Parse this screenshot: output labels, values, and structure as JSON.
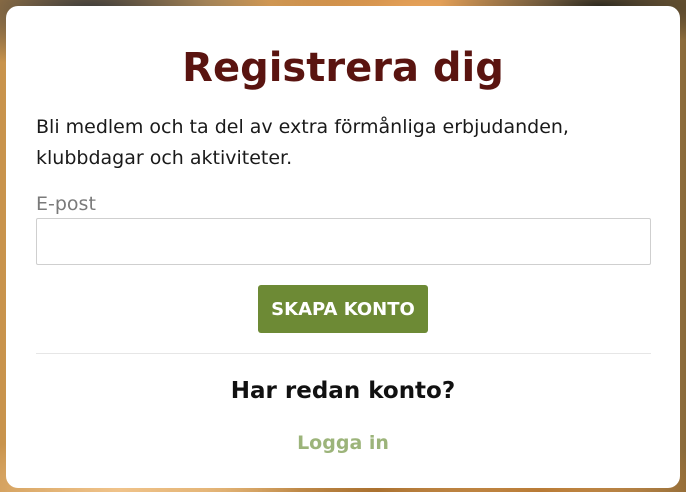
{
  "registration": {
    "title": "Registrera dig",
    "intro": "Bli medlem och ta del av extra förmånliga erbjudanden, klubbdagar och aktiviteter.",
    "email_label": "E-post",
    "email_value": "",
    "submit_label": "SKAPA KONTO"
  },
  "login": {
    "heading": "Har redan konto?",
    "link_label": "Logga in"
  },
  "colors": {
    "title": "#5a1410",
    "button": "#6d8a35",
    "link": "#9cb47a"
  }
}
